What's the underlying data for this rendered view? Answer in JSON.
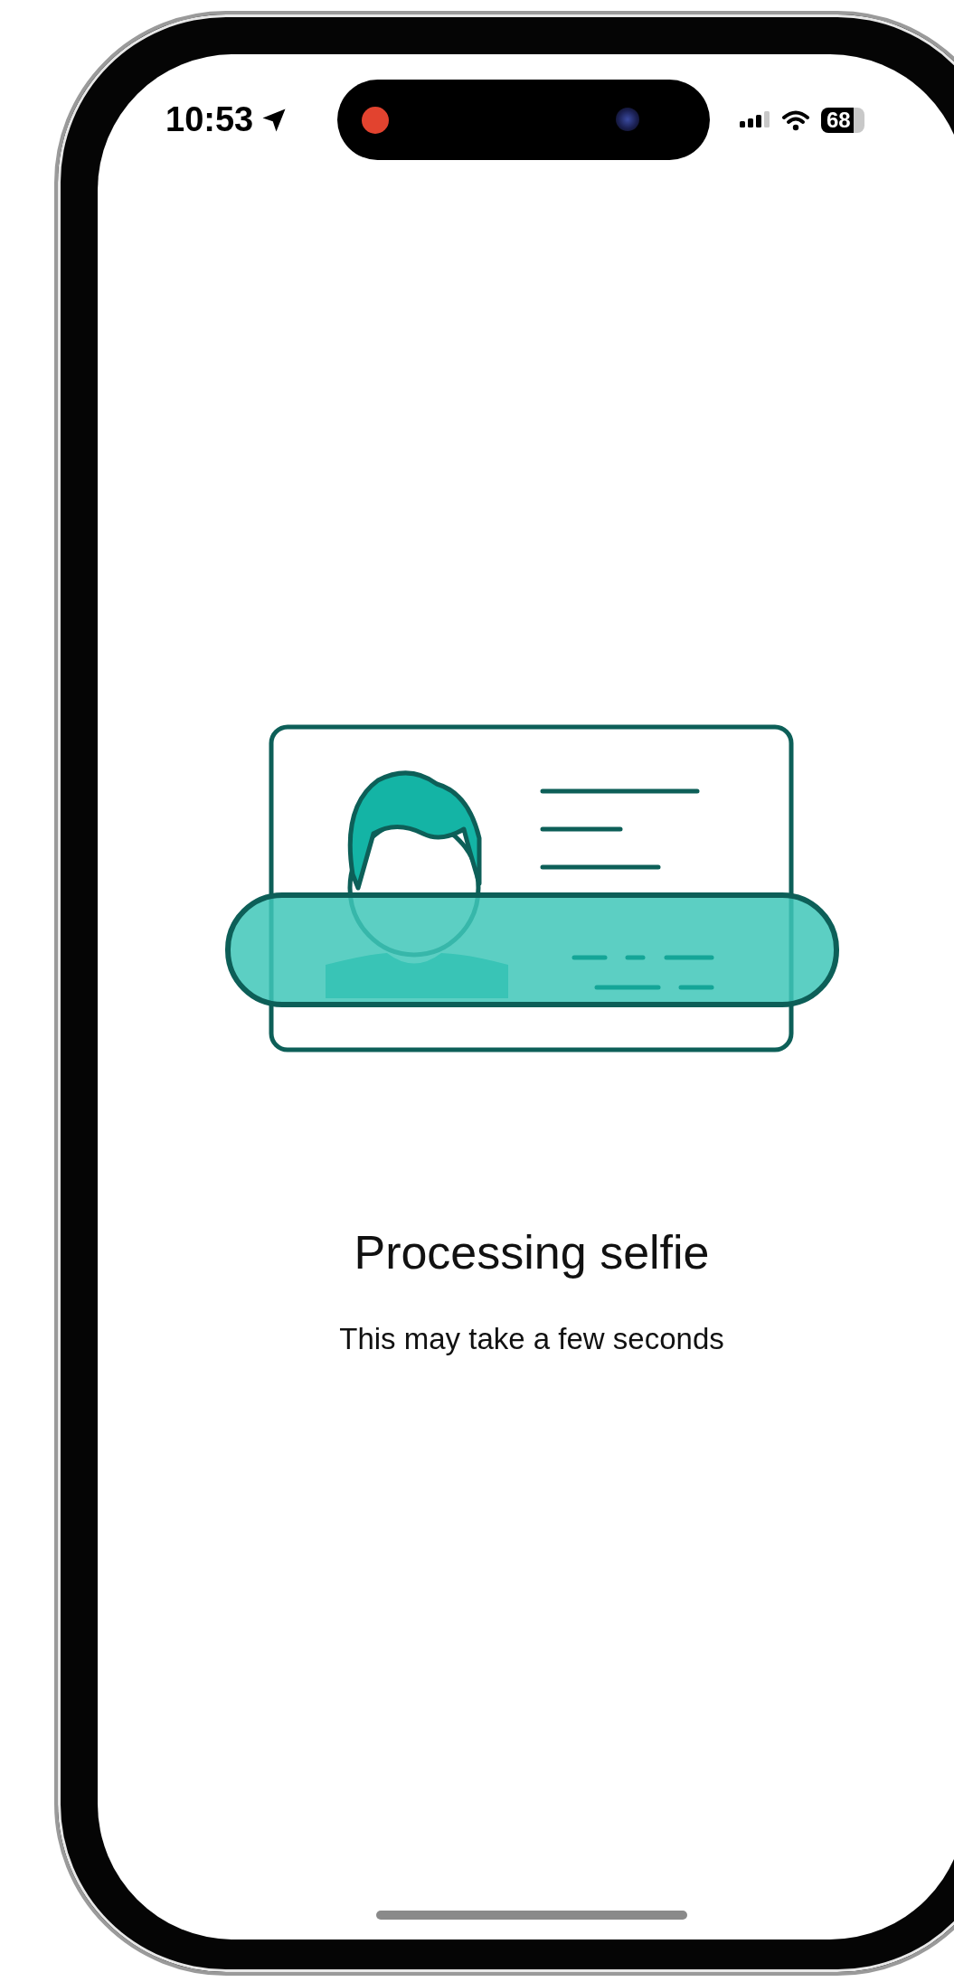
{
  "status_bar": {
    "time": "10:53",
    "battery": "68"
  },
  "title": "Processing selfie",
  "subtitle": "This may take a few seconds"
}
